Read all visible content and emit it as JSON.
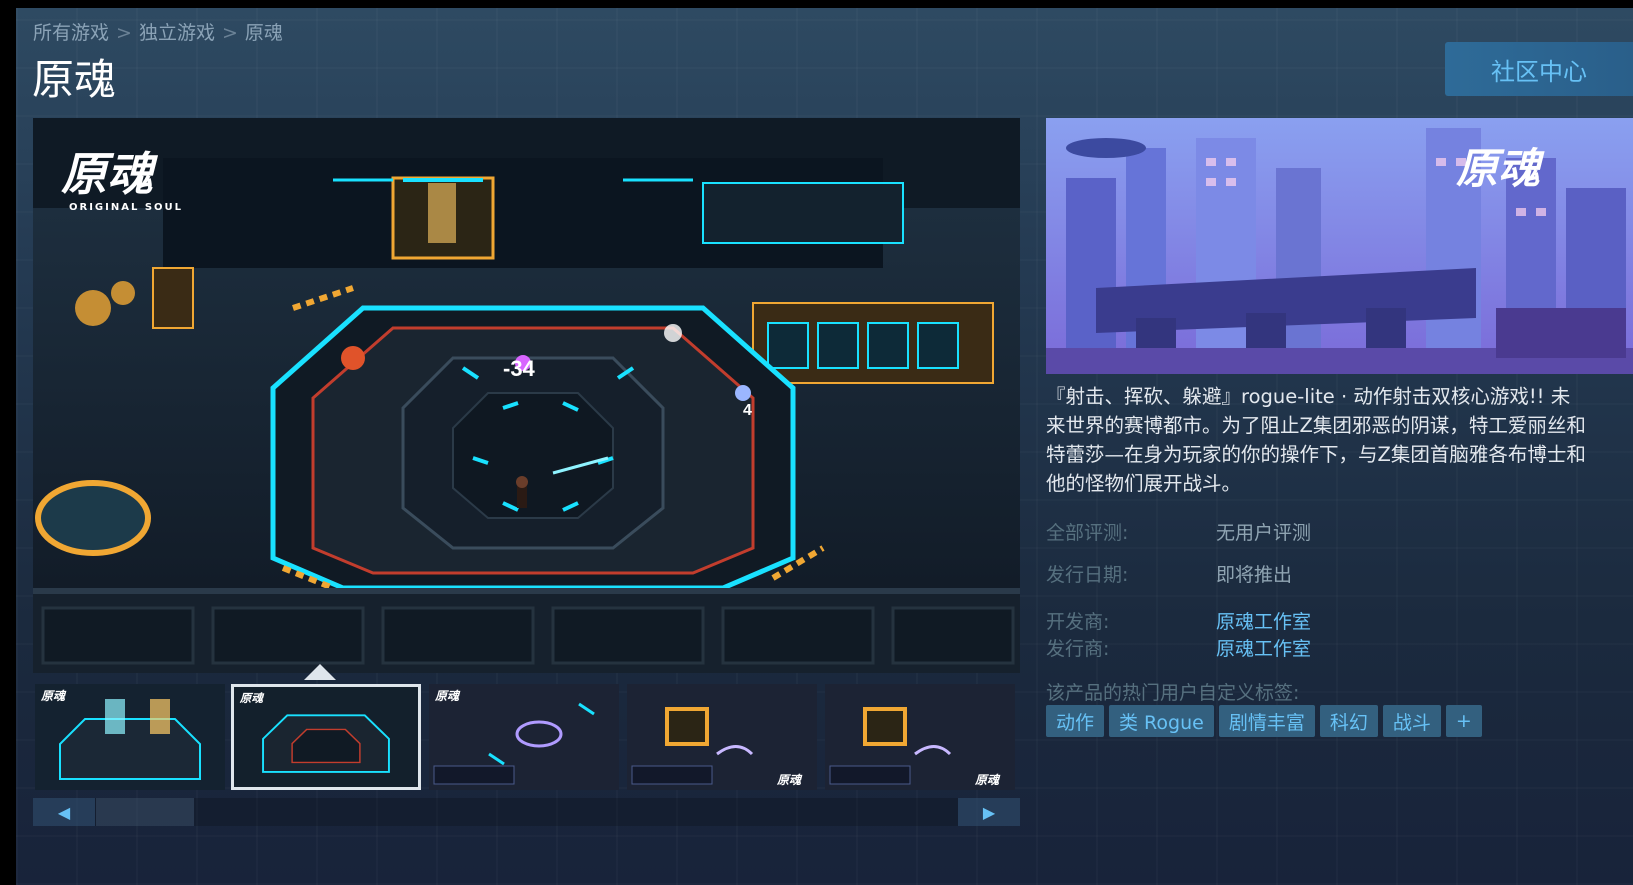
{
  "breadcrumb": {
    "all_games": "所有游戏",
    "indie": "独立游戏",
    "current": "原魂",
    "separator": ">"
  },
  "app": {
    "title": "原魂"
  },
  "header": {
    "community_button": "社区中心"
  },
  "main_screenshot": {
    "logo_text": "原魂",
    "logo_subtext": "ORIGINAL SOUL",
    "damage_text": "-34",
    "small_number": "4"
  },
  "thumbnails": [
    {
      "logo": "原魂",
      "selected": false
    },
    {
      "logo": "原魂",
      "selected": true
    },
    {
      "logo": "原魂",
      "selected": false
    },
    {
      "logo": "原魂",
      "selected": false
    },
    {
      "logo": "原魂",
      "selected": false
    }
  ],
  "scroll": {
    "left_icon": "◀",
    "right_icon": "▶"
  },
  "capsule": {
    "logo_text": "原魂"
  },
  "description": "『射击、挥砍、躲避』rogue-lite · 动作射击双核心游戏!! 未来世界的赛博都市。为了阻止Z集团邪恶的阴谋，特工爱丽丝和特蕾莎—在身为玩家的你的操作下，与Z集团首脑雅各布博士和他的怪物们展开战斗。",
  "info": {
    "reviews_label": "全部评测:",
    "reviews_value": "无用户评测",
    "release_label": "发行日期:",
    "release_value": "即将推出",
    "developer_label": "开发商:",
    "developer_value": "原魂工作室",
    "publisher_label": "发行商:",
    "publisher_value": "原魂工作室"
  },
  "tags_label": "该产品的热门用户自定义标签:",
  "tags": [
    "动作",
    "类 Rogue",
    "剧情丰富",
    "科幻",
    "战斗",
    "+"
  ],
  "colors": {
    "accent": "#67c1f5",
    "tag_bg": "#33607f",
    "button_bg": "#2e6b98",
    "neon": "#19e1ff"
  }
}
